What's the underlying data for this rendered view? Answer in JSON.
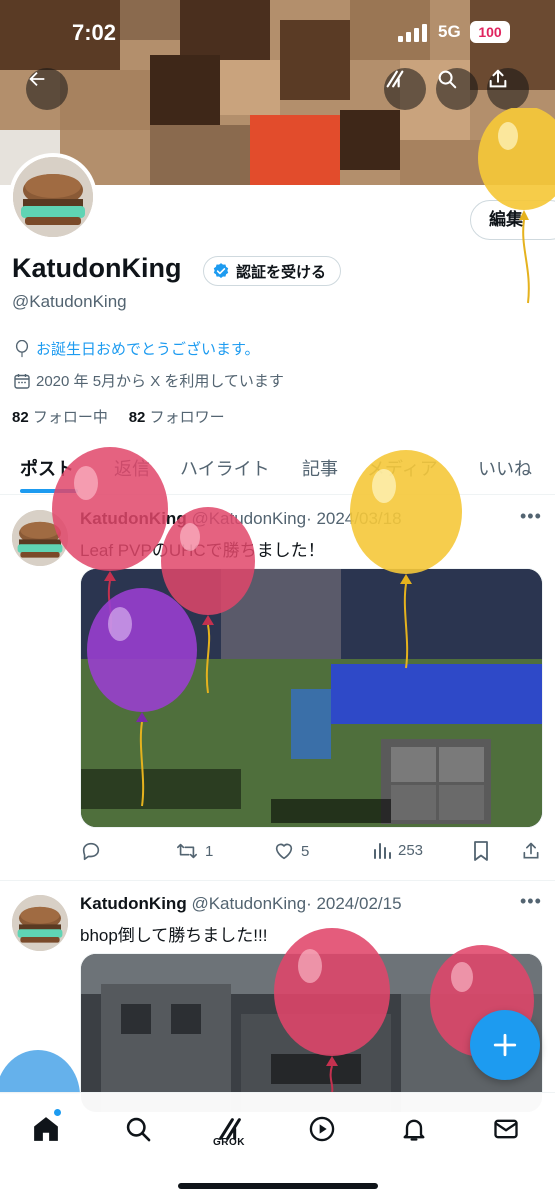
{
  "status_bar": {
    "time": "7:02",
    "network": "5G",
    "battery": "100"
  },
  "header": {
    "back_icon": "arrow-left-icon",
    "grok_icon": "grok-icon",
    "search_icon": "search-icon",
    "share_icon": "share-icon"
  },
  "profile": {
    "name": "KatudonKing",
    "handle": "@KatudonKing",
    "verify_label": "認証を受ける",
    "edit_label": "編集",
    "birthday_text": "お誕生日おめでとうございます。",
    "joined_text": "2020 年 5月から X を利用しています",
    "following_count": "82",
    "following_label": "フォロー中",
    "followers_count": "82",
    "followers_label": "フォロワー"
  },
  "tabs": [
    "ポスト",
    "返信",
    "ハイライト",
    "記事",
    "メディア",
    "いいね"
  ],
  "active_tab": "ポスト",
  "posts": [
    {
      "name": "KatudonKing",
      "handle": "@KatudonKing",
      "date": "· 2024/03/18",
      "text": "Leaf PVPのUHCで勝ちました！",
      "replies": "",
      "reposts": "1",
      "likes": "5",
      "views": "253"
    },
    {
      "name": "KatudonKing",
      "handle": "@KatudonKing",
      "date": "· 2024/02/15",
      "text": "bhop倒して勝ちました!!!"
    }
  ],
  "bottom_nav": {
    "grok_label": "GROK"
  },
  "colors": {
    "accent": "#1d9bf0",
    "text": "#0f1419",
    "muted": "#536471",
    "balloon_pink": "#e0466a",
    "balloon_yellow": "#f4c430",
    "balloon_purple": "#9b3fd1"
  }
}
